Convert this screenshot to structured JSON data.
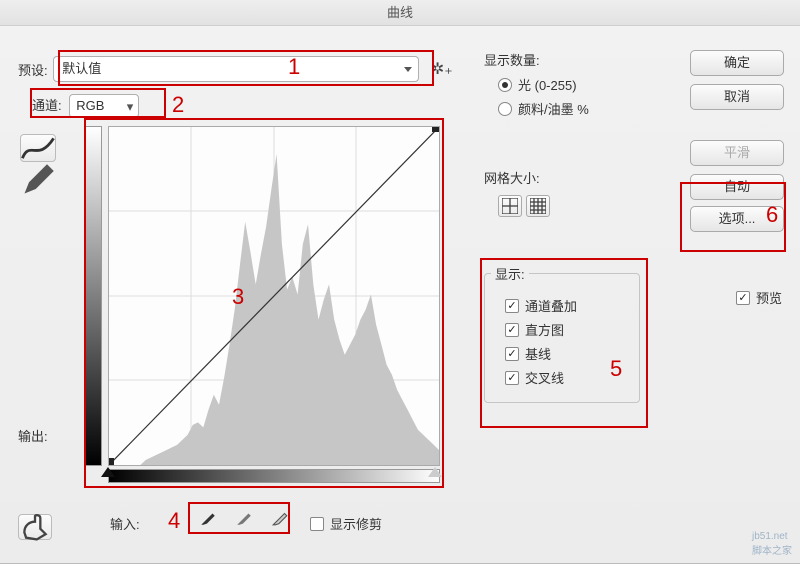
{
  "window": {
    "title": "曲线"
  },
  "preset": {
    "label": "预设:",
    "value": "默认值"
  },
  "channel": {
    "label": "通道:",
    "value": "RGB"
  },
  "output_label": "输出:",
  "input_label": "输入:",
  "show_clipping": {
    "label": "显示修剪"
  },
  "display_qty": {
    "label": "显示数量:",
    "opt_light": "光 (0-255)",
    "opt_ink": "颜料/油墨 %"
  },
  "grid": {
    "label": "网格大小:"
  },
  "display": {
    "label": "显示:",
    "overlay": "通道叠加",
    "histogram": "直方图",
    "baseline": "基线",
    "crosshair": "交叉线"
  },
  "buttons": {
    "ok": "确定",
    "cancel": "取消",
    "smooth": "平滑",
    "auto": "自动",
    "options": "选项..."
  },
  "preview": {
    "label": "预览"
  },
  "annotations": {
    "r1": "1",
    "r2": "2",
    "r3": "3",
    "r4": "4",
    "r5": "5",
    "r6": "6"
  },
  "watermark": "jb51.net\n脚本之家",
  "chart_data": {
    "type": "line",
    "title": "",
    "xlabel": "输入",
    "ylabel": "输出",
    "xlim": [
      0,
      255
    ],
    "ylim": [
      0,
      255
    ],
    "series": [
      {
        "name": "curve",
        "x": [
          0,
          255
        ],
        "y": [
          0,
          255
        ]
      }
    ],
    "histogram_approx": [
      0,
      0,
      0,
      0,
      0,
      0,
      0,
      2,
      3,
      4,
      5,
      6,
      7,
      8,
      10,
      12,
      16,
      17,
      15,
      22,
      28,
      24,
      35,
      48,
      62,
      80,
      97,
      85,
      72,
      84,
      95,
      110,
      124,
      88,
      70,
      75,
      68,
      88,
      96,
      72,
      58,
      66,
      72,
      58,
      50,
      44,
      48,
      52,
      58,
      62,
      68,
      56,
      48,
      40,
      36,
      30,
      26,
      22,
      18,
      14,
      12,
      10,
      8,
      6
    ]
  }
}
